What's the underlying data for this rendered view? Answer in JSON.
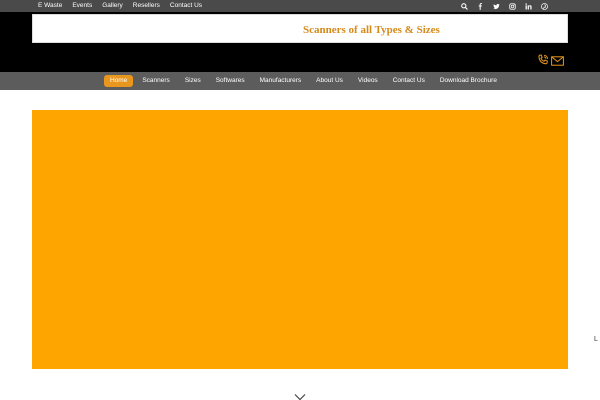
{
  "topbar": {
    "links": [
      "E Waste",
      "Events",
      "Gallery",
      "Resellers",
      "Contact Us"
    ],
    "social_icons": [
      "search-icon",
      "facebook-icon",
      "twitter-icon",
      "instagram-icon",
      "linkedin-icon",
      "pinterest-icon"
    ]
  },
  "header": {
    "tagline": "Scanners of all Types & Sizes",
    "contact_icons": [
      "phone-icon",
      "mail-icon"
    ]
  },
  "nav": {
    "items": [
      "Home",
      "Scanners",
      "Sizes",
      "Softwares",
      "Manufacturers",
      "About Us",
      "Videos",
      "Contact Us",
      "Download Brochure"
    ],
    "active_index": 0
  },
  "hero": {
    "background_color": "#ffa500"
  },
  "side_text": "L",
  "colors": {
    "accent": "#e8971e",
    "tagline": "#d58a1a",
    "topbar": "#4a4a4a",
    "navbar": "#5c5c5c"
  }
}
